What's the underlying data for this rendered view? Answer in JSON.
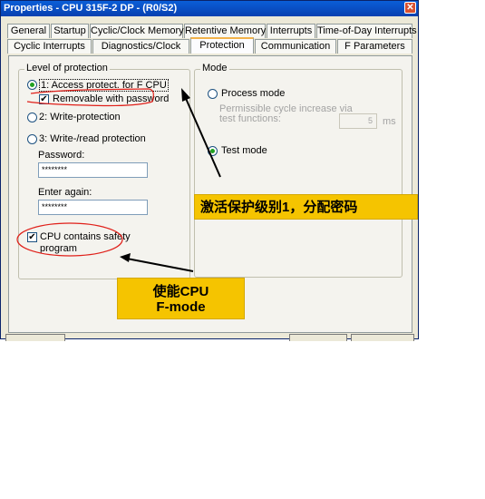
{
  "window": {
    "title": "Properties - CPU 315F-2 DP - (R0/S2)",
    "close_glyph": "✕"
  },
  "tabs_row1": [
    "General",
    "Startup",
    "Cyclic/Clock Memory",
    "Retentive Memory",
    "Interrupts",
    "Time-of-Day Interrupts"
  ],
  "tabs_row2": [
    "Cyclic Interrupts",
    "Diagnostics/Clock",
    "Protection",
    "Communication",
    "F Parameters"
  ],
  "protection": {
    "legend": "Level of protection",
    "option1": "1: Access protect. for F CPU",
    "removable": "Removable with password",
    "option2": "2: Write-protection",
    "option3": "3: Write-/read protection",
    "password_label": "Password:",
    "password_value": "********",
    "enter_again_label": "Enter again:",
    "enter_again_value": "********",
    "safety_program": "CPU contains safety program",
    "safety_line1": "CPU contains safety",
    "safety_line2": "program"
  },
  "mode": {
    "legend": "Mode",
    "process_mode": "Process mode",
    "permissible_line1": "Permissible  cycle increase via",
    "permissible_line2": "test functions:",
    "cycle_value": "5",
    "cycle_unit": "ms",
    "test_mode": "Test mode"
  },
  "annotations": {
    "box1": "激活保护级别1，分配密码",
    "box2_line1": "使能CPU",
    "box2_line2": "F-mode",
    "color": "#f5c400",
    "ellipse_color": "#e0201a"
  },
  "colors": {
    "titlebar": "#0a5ed8",
    "tab_active_accent": "#f2b34a",
    "radio_dot": "#21a121"
  }
}
